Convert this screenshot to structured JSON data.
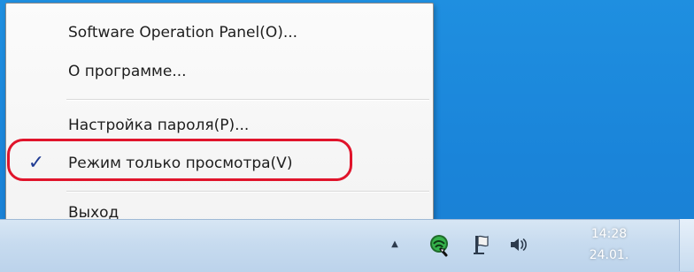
{
  "menu": {
    "items": [
      {
        "label": "Software Operation Panel(O)..."
      },
      {
        "label": "О программе..."
      },
      {
        "label": "Настройка пароля(P)..."
      },
      {
        "label": "Режим только просмотра(V)",
        "checked": true,
        "check_glyph": "✓"
      },
      {
        "label": "Выход"
      }
    ]
  },
  "taskbar": {
    "tray_chevron": "▲",
    "clock": {
      "time": "14:28",
      "date": "24.01."
    }
  },
  "icons": {
    "tray": [
      "network-icon",
      "flag-icon",
      "volume-icon"
    ]
  },
  "colors": {
    "desktop_blue": "#1a84d9",
    "highlight_red": "#e0142b",
    "check_blue": "#1f3b93"
  }
}
